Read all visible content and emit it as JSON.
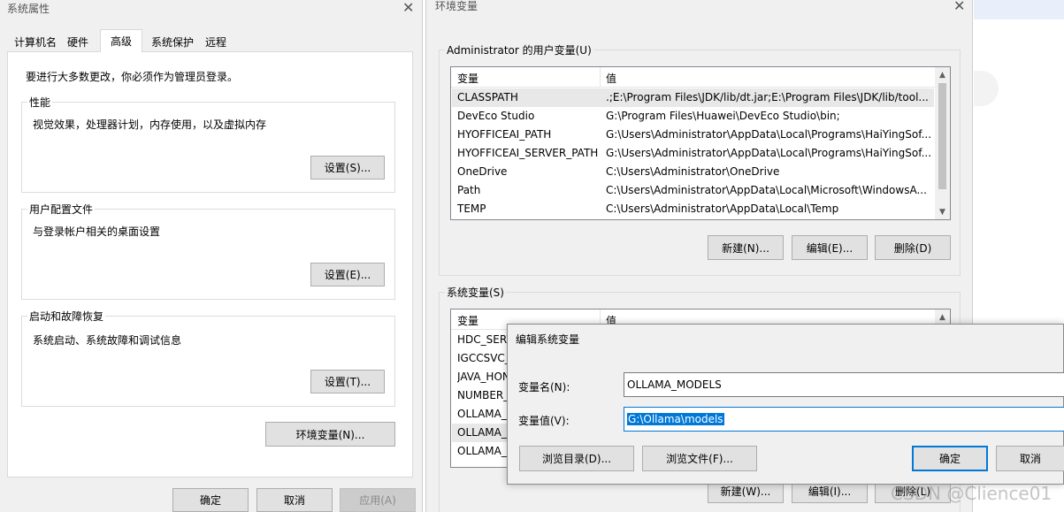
{
  "sys_props": {
    "title": "系统属性",
    "tabs": [
      "计算机名",
      "硬件",
      "高级",
      "系统保护",
      "远程"
    ],
    "admin_notice": "要进行大多数更改，你必须作为管理员登录。",
    "perf": {
      "legend": "性能",
      "desc": "视觉效果，处理器计划，内存使用，以及虚拟内存",
      "button": "设置(S)..."
    },
    "profile": {
      "legend": "用户配置文件",
      "desc": "与登录帐户相关的桌面设置",
      "button": "设置(E)..."
    },
    "startup": {
      "legend": "启动和故障恢复",
      "desc": "系统启动、系统故障和调试信息",
      "button": "设置(T)..."
    },
    "env_button": "环境变量(N)...",
    "ok": "确定",
    "cancel": "取消",
    "apply": "应用(A)"
  },
  "env_vars": {
    "title": "环境变量",
    "user_legend": "Administrator 的用户变量(U)",
    "col_var": "变量",
    "col_val": "值",
    "user_rows": [
      {
        "name": "CLASSPATH",
        "value": ".;E:\\Program Files\\JDK/lib/dt.jar;E:\\Program Files\\JDK/lib/tool..."
      },
      {
        "name": "DevEco Studio",
        "value": "G:\\Program Files\\Huawei\\DevEco Studio\\bin;"
      },
      {
        "name": "HYOFFICEAI_PATH",
        "value": "G:\\Users\\Administrator\\AppData\\Local\\Programs\\HaiYingSof..."
      },
      {
        "name": "HYOFFICEAI_SERVER_PATH",
        "value": "G:\\Users\\Administrator\\AppData\\Local\\Programs\\HaiYingSof..."
      },
      {
        "name": "OneDrive",
        "value": "C:\\Users\\Administrator\\OneDrive"
      },
      {
        "name": "Path",
        "value": "C:\\Users\\Administrator\\AppData\\Local\\Microsoft\\WindowsA..."
      },
      {
        "name": "TEMP",
        "value": "C:\\Users\\Administrator\\AppData\\Local\\Temp"
      }
    ],
    "user_new": "新建(N)...",
    "user_edit": "编辑(E)...",
    "user_delete": "删除(D)",
    "sys_legend": "系统变量(S)",
    "sys_rows": [
      {
        "name": "HDC_SERV"
      },
      {
        "name": "IGCCSVC_"
      },
      {
        "name": "JAVA_HON"
      },
      {
        "name": "NUMBER_"
      },
      {
        "name": "OLLAMA_I"
      },
      {
        "name": "OLLAMA_I"
      },
      {
        "name": "OLLAMA_C"
      }
    ],
    "sys_new": "新建(W)...",
    "sys_edit": "编辑(I)...",
    "sys_delete": "删除(L)"
  },
  "edit_dialog": {
    "title": "编辑系统变量",
    "name_label": "变量名(N):",
    "value_label": "变量值(V):",
    "name_value": "OLLAMA_MODELS",
    "value_value": "G:\\Ollama\\models",
    "browse_dir": "浏览目录(D)...",
    "browse_file": "浏览文件(F)...",
    "ok": "确定",
    "cancel": "取消"
  },
  "watermark": "CSDN @Clience01"
}
